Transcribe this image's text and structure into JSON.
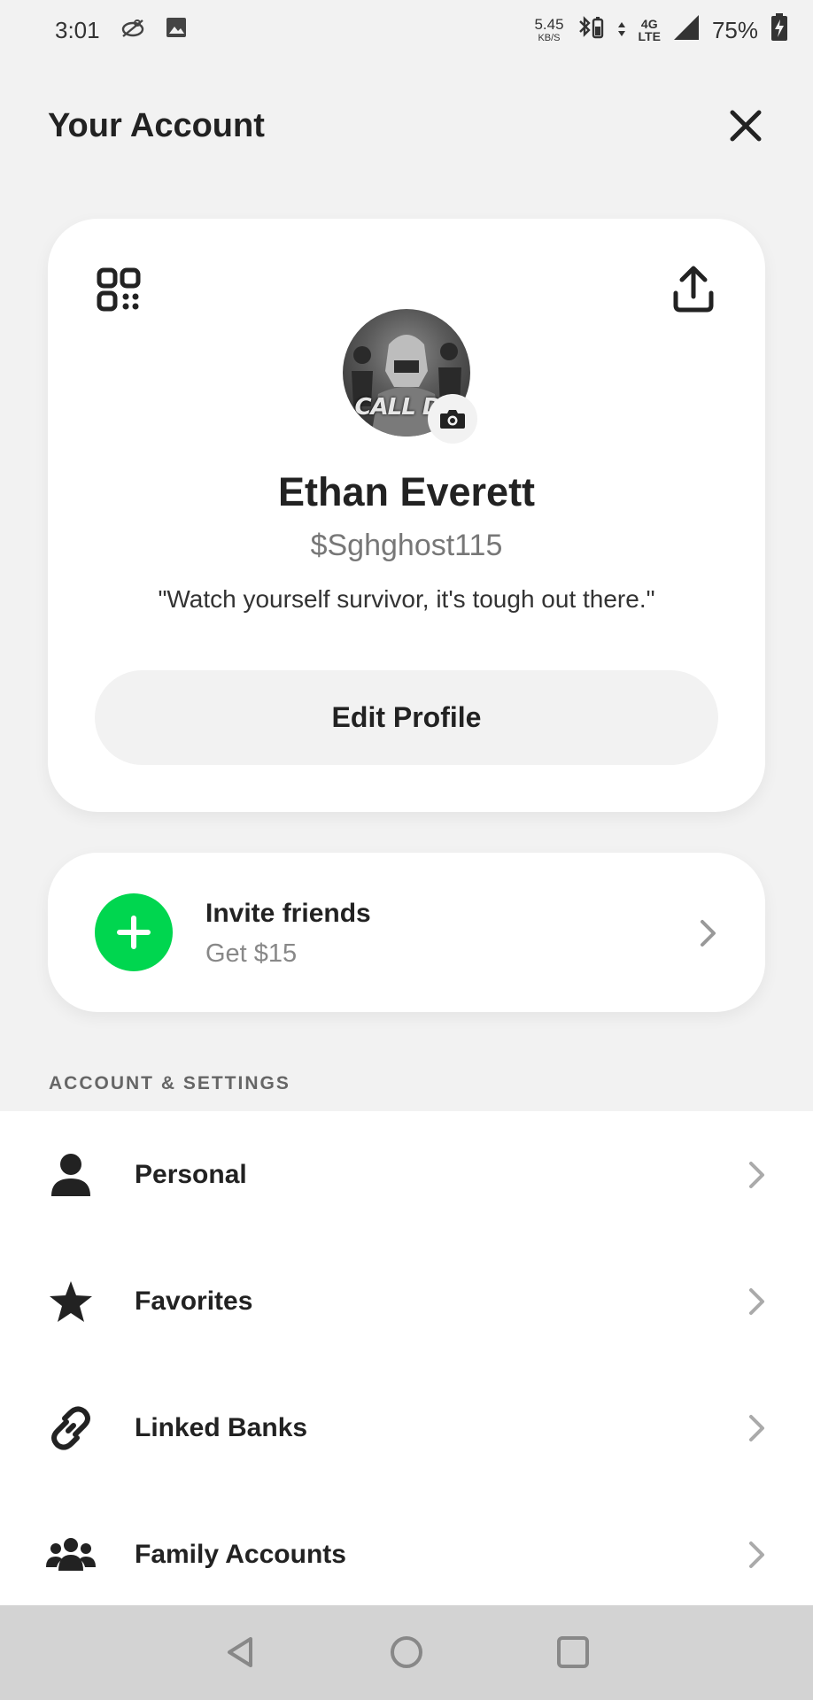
{
  "status_bar": {
    "time": "3:01",
    "net_speed_value": "5.45",
    "net_speed_unit": "KB/S",
    "network_top": "4G",
    "network_bottom": "LTE",
    "battery": "75%"
  },
  "header": {
    "title": "Your Account"
  },
  "profile": {
    "avatar_text": "CALL DU",
    "name": "Ethan Everett",
    "cashtag": "$Sghghost115",
    "bio": "\"Watch yourself survivor, it's tough out there.\"",
    "edit_label": "Edit Profile"
  },
  "invite": {
    "title": "Invite friends",
    "subtitle": "Get $15"
  },
  "settings": {
    "section_title": "ACCOUNT & SETTINGS",
    "items": [
      {
        "label": "Personal",
        "icon": "person-icon"
      },
      {
        "label": "Favorites",
        "icon": "star-icon"
      },
      {
        "label": "Linked Banks",
        "icon": "link-icon"
      },
      {
        "label": "Family Accounts",
        "icon": "family-icon"
      }
    ]
  },
  "colors": {
    "background": "#f2f2f2",
    "card": "#ffffff",
    "accent_green": "#00d64f",
    "text_primary": "#222222",
    "text_secondary": "#888888",
    "nav_bar": "#d3d3d3"
  }
}
